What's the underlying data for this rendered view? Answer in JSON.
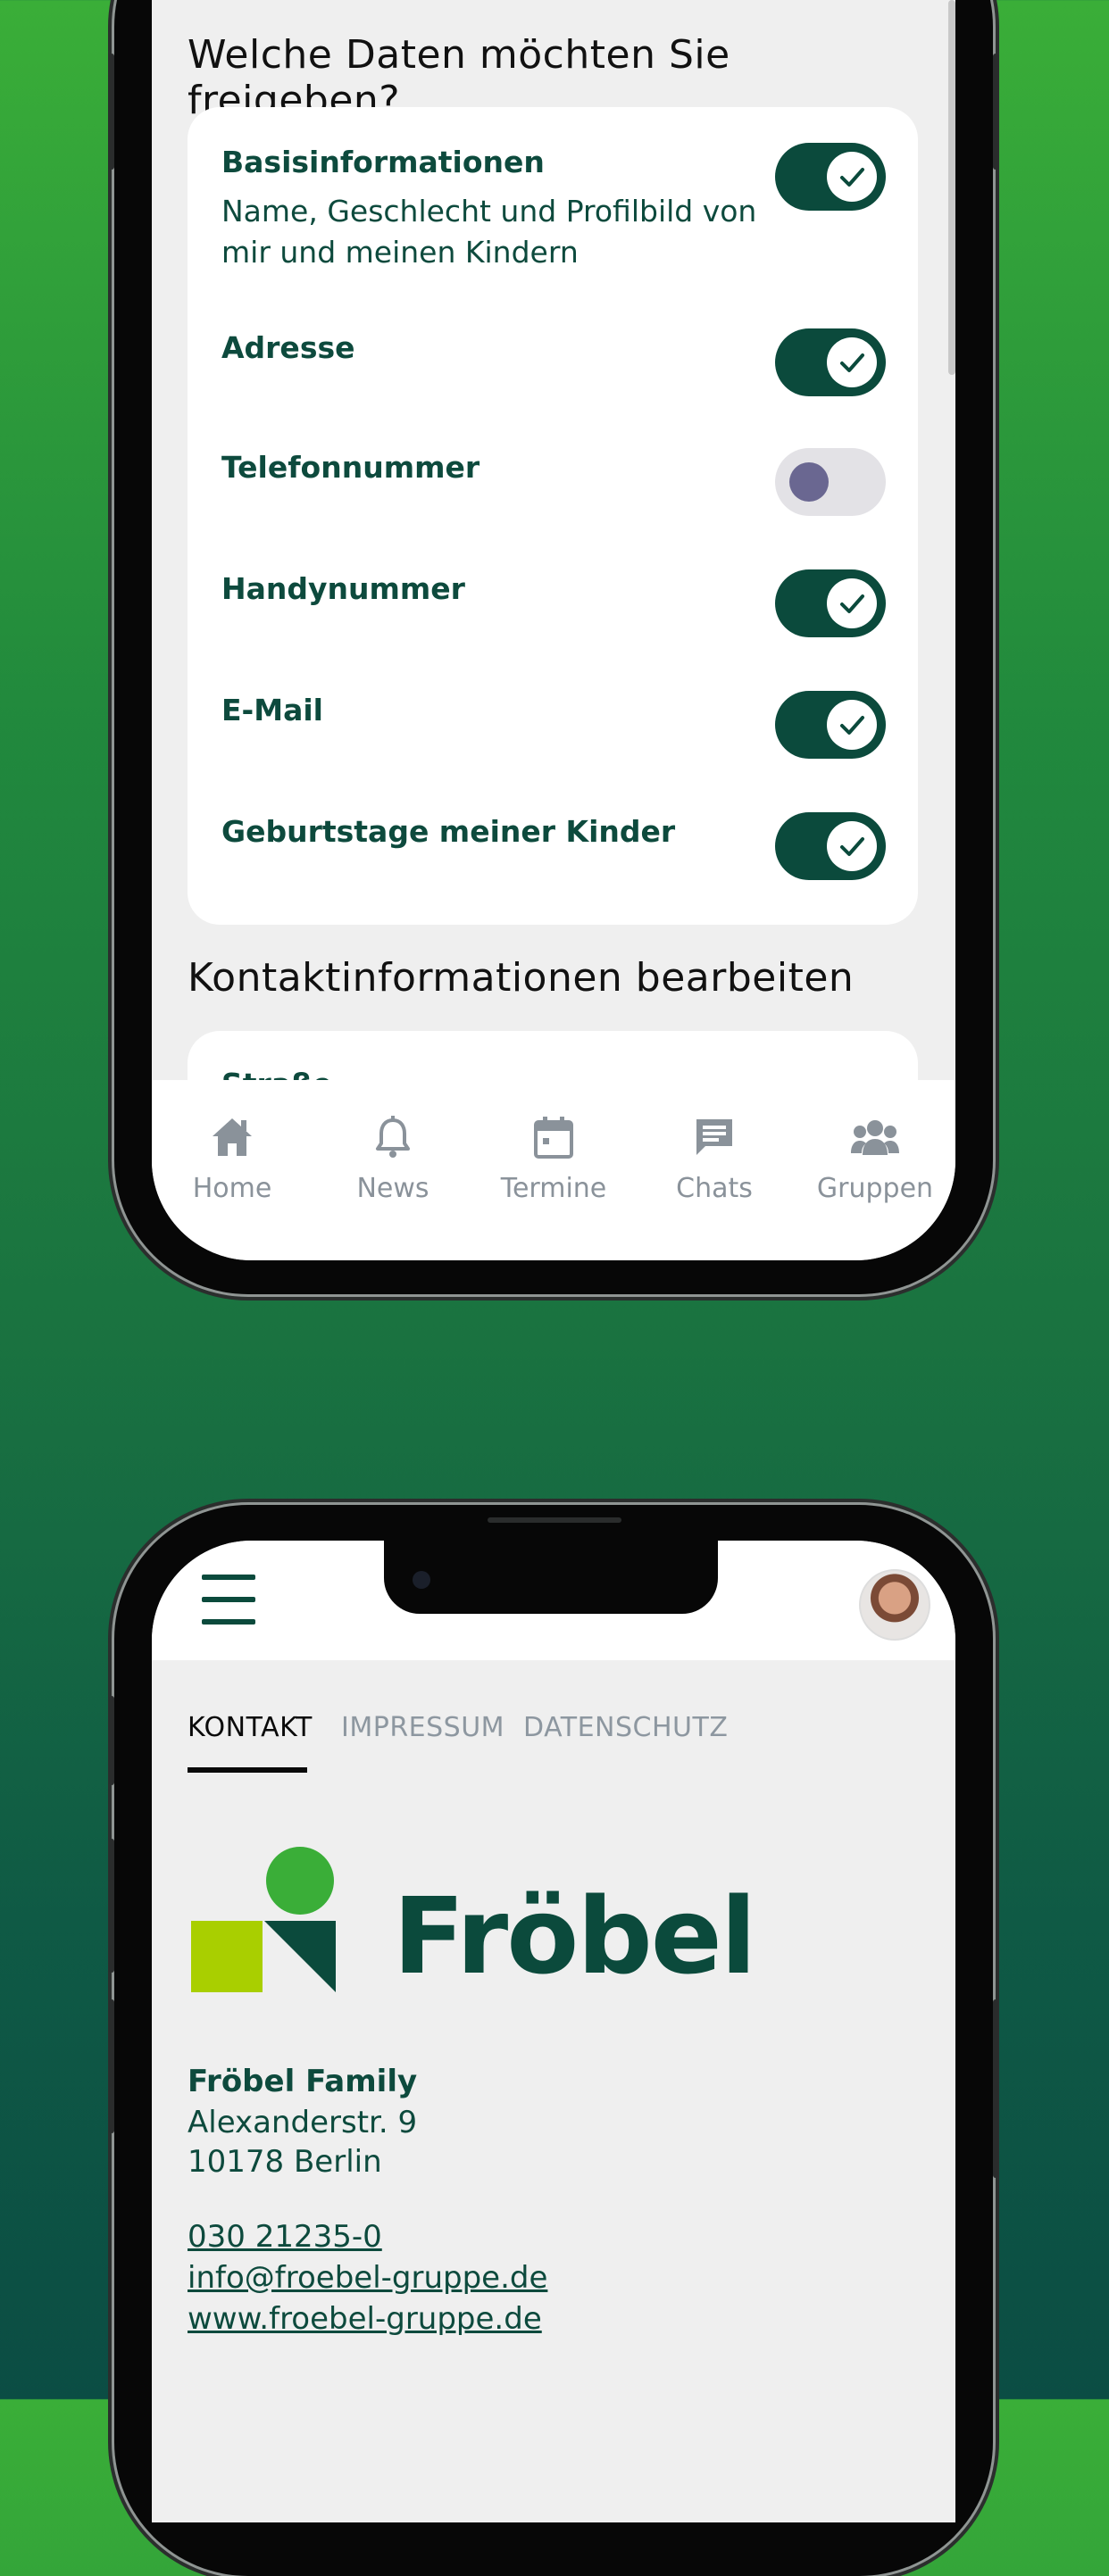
{
  "top_phone": {
    "share_section_title": "Welche Daten möchten Sie freigeben?",
    "share_items": [
      {
        "label": "Basisinformationen",
        "description": "Name, Geschlecht und Profilbild von mir und meinen Kindern",
        "enabled": true
      },
      {
        "label": "Adresse",
        "enabled": true
      },
      {
        "label": "Telefonnummer",
        "enabled": false
      },
      {
        "label": "Handynummer",
        "enabled": true
      },
      {
        "label": "E-Mail",
        "enabled": true
      },
      {
        "label": "Geburtstage meiner Kinder",
        "enabled": true
      }
    ],
    "edit_section_title": "Kontaktinformationen bearbeiten",
    "edit_first_field_label": "Straße",
    "tabbar": [
      {
        "label": "Home",
        "icon": "home-icon"
      },
      {
        "label": "News",
        "icon": "bell-icon"
      },
      {
        "label": "Termine",
        "icon": "calendar-icon"
      },
      {
        "label": "Chats",
        "icon": "chat-icon"
      },
      {
        "label": "Gruppen",
        "icon": "group-icon"
      }
    ]
  },
  "bottom_phone": {
    "menu_icon": "hamburger-menu-icon",
    "avatar_icon": "user-avatar",
    "tabs": [
      {
        "label": "KONTAKT",
        "active": true
      },
      {
        "label": "IMPRESSUM",
        "active": false
      },
      {
        "label": "DATENSCHUTZ",
        "active": false
      }
    ],
    "logo_text": "Fröbel",
    "company_name": "Fröbel Family",
    "street": "Alexanderstr. 9",
    "city": "10178 Berlin",
    "phone": "030 21235-0",
    "email": "info@froebel-gruppe.de",
    "website": "www.froebel-gruppe.de"
  },
  "colors": {
    "brand_dark": "#0b4a3c",
    "brand_green": "#3aae38",
    "brand_lime": "#a9cf00",
    "toggle_off_knob": "#6a6791",
    "tab_inactive": "#8a929a"
  }
}
